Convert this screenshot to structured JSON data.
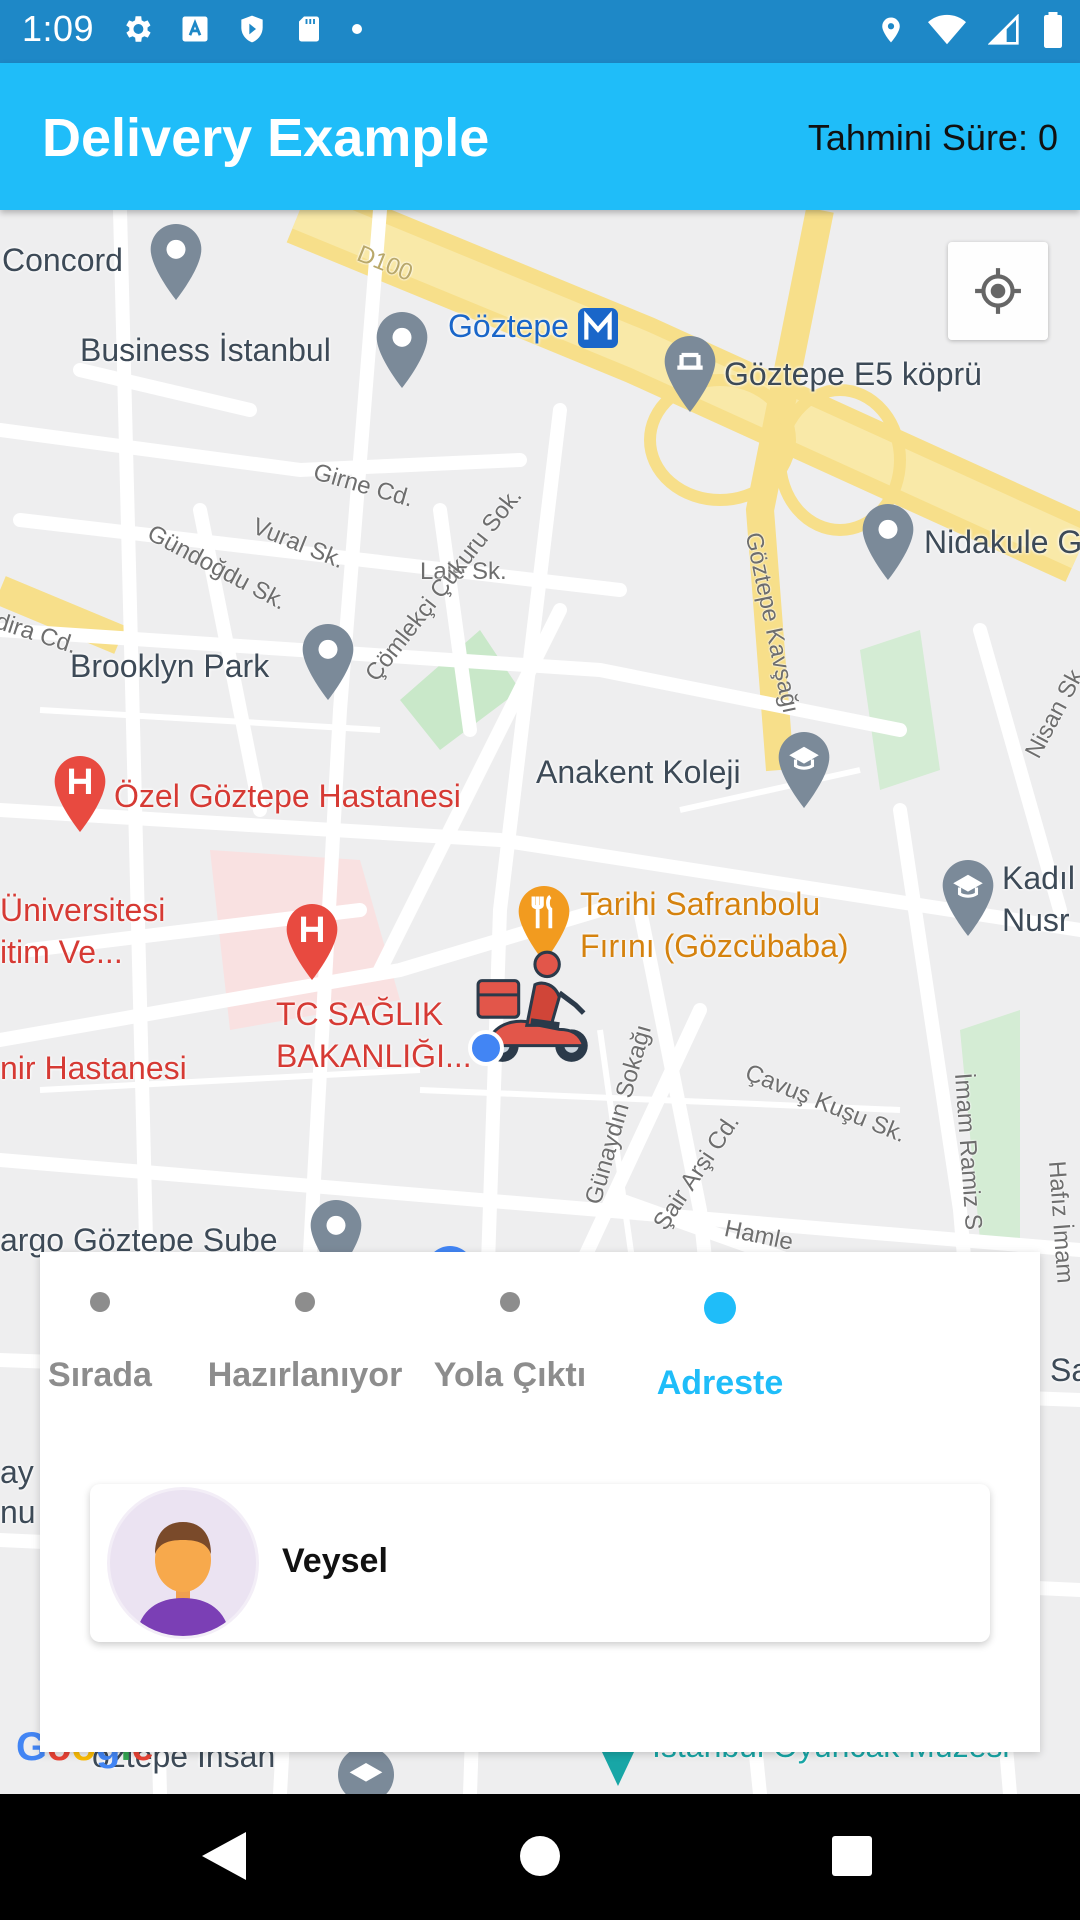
{
  "status_bar": {
    "time": "1:09",
    "icons_left": [
      "gear-icon",
      "a-icon",
      "shield-icon",
      "sd-card-icon",
      "dot-icon"
    ],
    "icons_right": [
      "location-icon",
      "wifi-icon",
      "signal-icon",
      "battery-icon"
    ]
  },
  "app_bar": {
    "title": "Delivery Example",
    "eta_label": "Tahmini Süre:",
    "eta_value": "0",
    "color": "#1fbdf9"
  },
  "map": {
    "places": {
      "concord": "Concord",
      "business_istanbul": "Business İstanbul",
      "goztepe": "Göztepe",
      "goztepe_e5": "Göztepe E5 köprü",
      "nidakule": "Nidakule G",
      "brooklyn_park": "Brooklyn Park",
      "anakent": "Anakent Koleji",
      "ozel_goztepe": "Özel Göztepe Hastanesi",
      "universitesi": "Üniversitesi",
      "itim_ve": "itim Ve...",
      "tarihi_1": "Tarihi Safranbolu",
      "tarihi_2": "Fırını (Gözcübaba)",
      "kadi_1": "Kadıl",
      "kadi_2": "Nusr",
      "tc_saglik_1": "TC SAĞLIK",
      "tc_saglik_2": "BAKANLIĞI...",
      "hastanesi": "nir Hastanesi",
      "kargo": "argo Göztepe Sube",
      "sa": "Sa",
      "ay": "ay",
      "nu": "nu",
      "goztepe_insan": "öztepe İnsan",
      "oyuncak": "İstanbul Oyuncak Müzesi"
    },
    "streets": {
      "d100": "D100",
      "girne": "Girne Cd.",
      "vural": "Vural Sk.",
      "gundogdu": "Gündoğdu Sk.",
      "lale": "Lale Sk.",
      "comlekci": "Çömlekçi Çukuru Sok.",
      "kavsagi": "Göztepe Kavşağı",
      "nisan": "Nisan Sk.",
      "dira": "dira Cd.",
      "gunaydin": "Günaydın Sokağı",
      "sair": "Şair Arşi Cd.",
      "cavus": "Çavuş Kuşu Sk.",
      "imam": "İmam Ramiz S",
      "hafiz": "Hafız İmam",
      "hamle": "Hamle"
    },
    "google_logo": "Google"
  },
  "order_steps": [
    {
      "label": "Sırada",
      "active": false
    },
    {
      "label": "Hazırlanıyor",
      "active": false
    },
    {
      "label": "Yola Çıktı",
      "active": false
    },
    {
      "label": "Adreste",
      "active": true
    }
  ],
  "courier": {
    "name": "Veysel"
  },
  "nav_bar": {
    "buttons": [
      "back-icon",
      "home-icon",
      "recents-icon"
    ]
  }
}
